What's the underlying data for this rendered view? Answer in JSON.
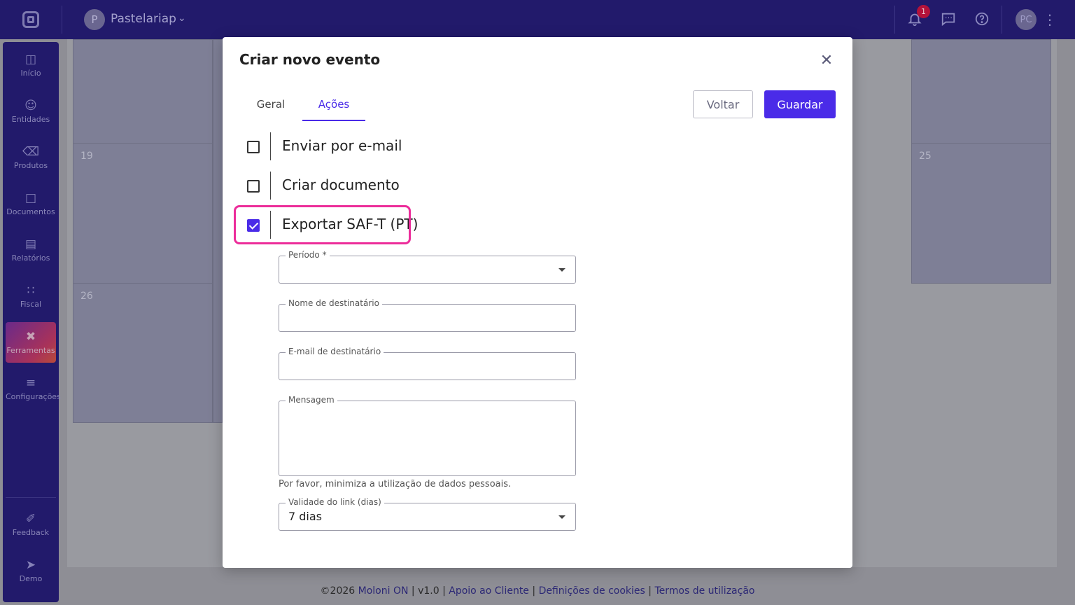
{
  "topbar": {
    "company_initial": "P",
    "company_name": "Pastelariap",
    "notification_count": "1",
    "user_initials": "PC"
  },
  "sidebar": {
    "items": [
      {
        "label": "Início",
        "icon": "dashboard-icon"
      },
      {
        "label": "Entidades",
        "icon": "person-icon"
      },
      {
        "label": "Produtos",
        "icon": "basket-icon"
      },
      {
        "label": "Documentos",
        "icon": "document-icon"
      },
      {
        "label": "Relatórios",
        "icon": "chart-icon"
      },
      {
        "label": "Fiscal",
        "icon": "fiscal-icon"
      },
      {
        "label": "Ferramentas",
        "icon": "tools-icon",
        "active": true
      },
      {
        "label": "Configurações",
        "icon": "sliders-icon"
      }
    ],
    "bottom_items": [
      {
        "label": "Feedback",
        "icon": "feedback-icon"
      },
      {
        "label": "Demo",
        "icon": "rocket-icon"
      }
    ]
  },
  "calendar": {
    "day_19": "19",
    "day_25": "25",
    "day_26": "26"
  },
  "modal": {
    "title": "Criar novo evento",
    "tabs": [
      {
        "label": "Geral",
        "active": false
      },
      {
        "label": "Ações",
        "active": true
      }
    ],
    "back_label": "Voltar",
    "save_label": "Guardar",
    "actions": [
      {
        "label": "Enviar por e-mail",
        "checked": false
      },
      {
        "label": "Criar documento",
        "checked": false
      },
      {
        "label": "Exportar SAF-T (PT)",
        "checked": true
      }
    ],
    "fields": {
      "period_label": "Período *",
      "period_value": "",
      "recipient_name_label": "Nome de destinatário",
      "recipient_name_value": "",
      "recipient_email_label": "E-mail de destinatário",
      "recipient_email_value": "",
      "message_label": "Mensagem",
      "message_value": "",
      "hint": "Por favor, minimiza a utilização de dados pessoais.",
      "link_validity_label": "Validade do link (dias)",
      "link_validity_value": "7 dias"
    }
  },
  "footer": {
    "copyright": "©2026",
    "brand": "Moloni ON",
    "version": "v1.0",
    "support": "Apoio ao Cliente",
    "cookies": "Definições de cookies",
    "terms": "Termos de utilização",
    "separator": "|"
  },
  "colors": {
    "brand_dark": "#221a6b",
    "accent": "#4a2be8",
    "highlight": "#ec2d9a"
  }
}
